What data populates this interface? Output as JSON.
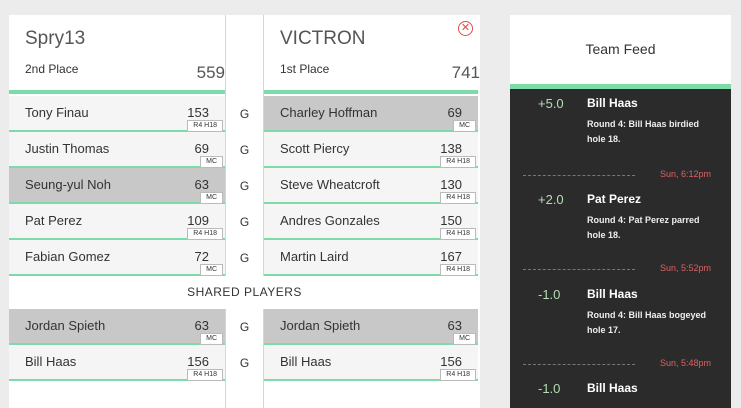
{
  "left_team": {
    "name": "Spry13",
    "place": "2nd Place",
    "score": "559"
  },
  "right_team": {
    "name": "VICTRON",
    "place": "1st Place",
    "score": "741"
  },
  "close_icon": "✕",
  "rows": [
    {
      "left": {
        "name": "Tony Finau",
        "score": "153",
        "badge": "R4 H18"
      },
      "g": "G",
      "right": {
        "name": "Charley Hoffman",
        "score": "69",
        "badge": "MC"
      }
    },
    {
      "left": {
        "name": "Justin Thomas",
        "score": "69",
        "badge": "MC"
      },
      "g": "G",
      "right": {
        "name": "Scott Piercy",
        "score": "138",
        "badge": "R4 H18"
      }
    },
    {
      "left": {
        "name": "Seung-yul Noh",
        "score": "63",
        "badge": "MC"
      },
      "g": "G",
      "right": {
        "name": "Steve Wheatcroft",
        "score": "130",
        "badge": "R4 H18"
      }
    },
    {
      "left": {
        "name": "Pat Perez",
        "score": "109",
        "badge": "R4 H18"
      },
      "g": "G",
      "right": {
        "name": "Andres Gonzales",
        "score": "150",
        "badge": "R4 H18"
      }
    },
    {
      "left": {
        "name": "Fabian Gomez",
        "score": "72",
        "badge": "MC"
      },
      "g": "G",
      "right": {
        "name": "Martin Laird",
        "score": "167",
        "badge": "R4 H18"
      }
    }
  ],
  "shared_label": "SHARED PLAYERS",
  "shared_rows": [
    {
      "left": {
        "name": "Jordan Spieth",
        "score": "63",
        "badge": "MC"
      },
      "g": "G",
      "right": {
        "name": "Jordan Spieth",
        "score": "63",
        "badge": "MC"
      }
    },
    {
      "left": {
        "name": "Bill Haas",
        "score": "156",
        "badge": "R4 H18"
      },
      "g": "G",
      "right": {
        "name": "Bill Haas",
        "score": "156",
        "badge": "R4 H18"
      }
    }
  ],
  "feed": {
    "title": "Team Feed",
    "entries": [
      {
        "delta": "+5.0",
        "player": "Bill Haas",
        "text": "Round 4: Bill Haas birdied hole 18.",
        "time": "Sun, 6:12pm"
      },
      {
        "delta": "+2.0",
        "player": "Pat Perez",
        "text": "Round 4: Pat Perez parred hole 18.",
        "time": "Sun, 5:52pm"
      },
      {
        "delta": "-1.0",
        "player": "Bill Haas",
        "text": "Round 4: Bill Haas bogeyed hole 17.",
        "time": "Sun, 5:48pm"
      },
      {
        "delta": "-1.0",
        "player": "Bill Haas",
        "text": "",
        "time": ""
      }
    ]
  },
  "colors": {
    "accent_green": "#7ddbaa",
    "feed_bg": "#2b2b2b",
    "time_red": "#e06060",
    "highlight_row": "#c8c8c8"
  }
}
